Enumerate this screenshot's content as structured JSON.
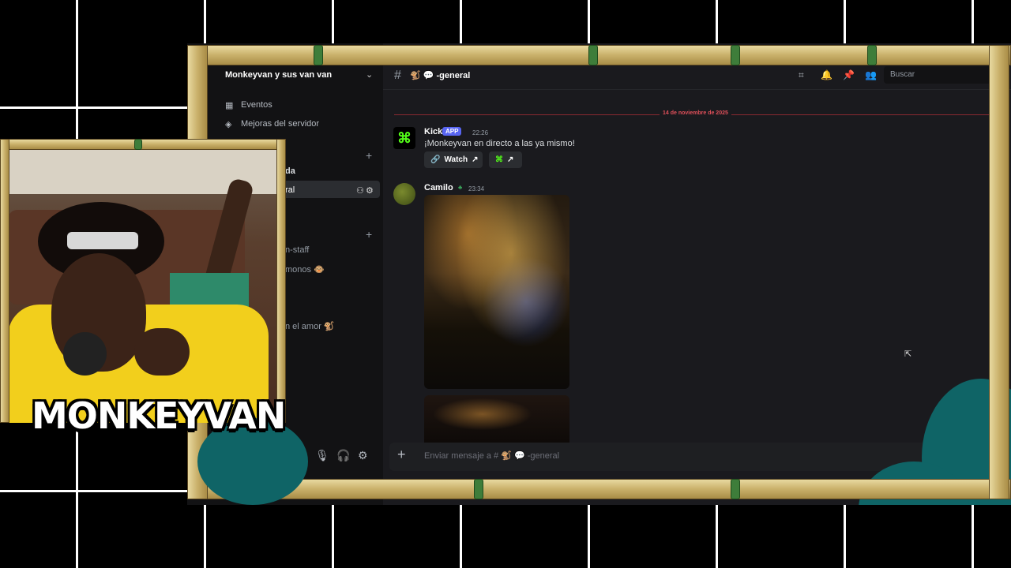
{
  "server": {
    "name": "Monkeyvan y sus van van"
  },
  "sidebar": {
    "items": [
      {
        "label": "Eventos",
        "icon": "calendar-icon"
      },
      {
        "label": "Mejoras del servidor",
        "icon": "boost-icon"
      }
    ],
    "channels": [
      {
        "label": "da"
      },
      {
        "label": "ral",
        "active": true
      },
      {
        "label": "n-staff"
      },
      {
        "label": "monos 🐵"
      },
      {
        "label": "n el amor 🐒"
      }
    ]
  },
  "channel": {
    "title": "🐒 💬 -general",
    "hash": "#"
  },
  "search": {
    "placeholder": "Buscar"
  },
  "date_divider": "14 de noviembre de 2025",
  "messages": [
    {
      "author": "Kick",
      "badge": "APP",
      "time": "22:26",
      "text": "¡Monkeyvan en directo a las ya mismo!",
      "button": "Watch"
    },
    {
      "author": "Camilo",
      "time": "23:34"
    }
  ],
  "composer": {
    "placeholder": "Enviar mensaje a # 🐒 💬 -general"
  },
  "overlay": {
    "logo_text": "MONKEYVAN"
  }
}
